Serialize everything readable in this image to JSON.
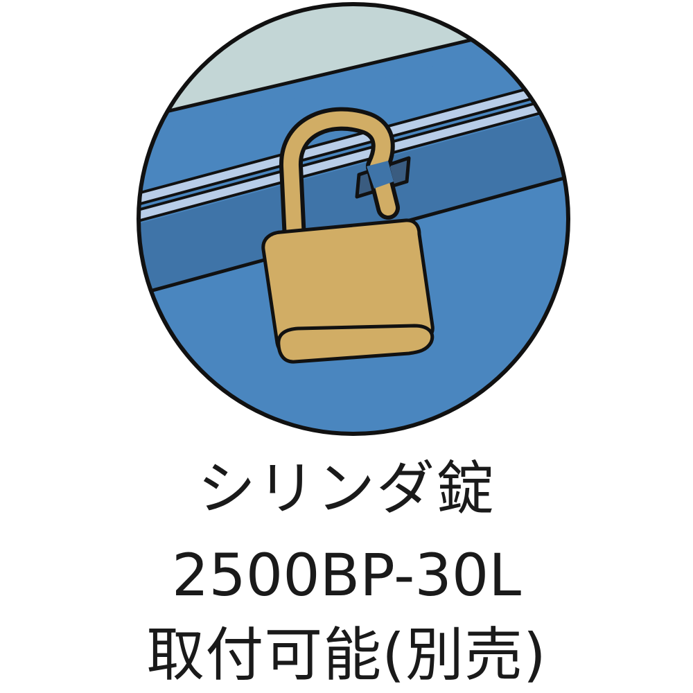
{
  "caption": {
    "line1": "シリンダ錠",
    "line2": "2500BP-30L",
    "line3": "取付可能(別売)"
  },
  "illustration": {
    "subject": "padlock-icon",
    "colors": {
      "box_blue": "#4a86bf",
      "box_dark_blue": "#3f74a8",
      "groove_light": "#b8cde8",
      "lid_gray": "#c3d6d6",
      "lock_gold": "#d1ad65",
      "outline": "#111111"
    }
  }
}
